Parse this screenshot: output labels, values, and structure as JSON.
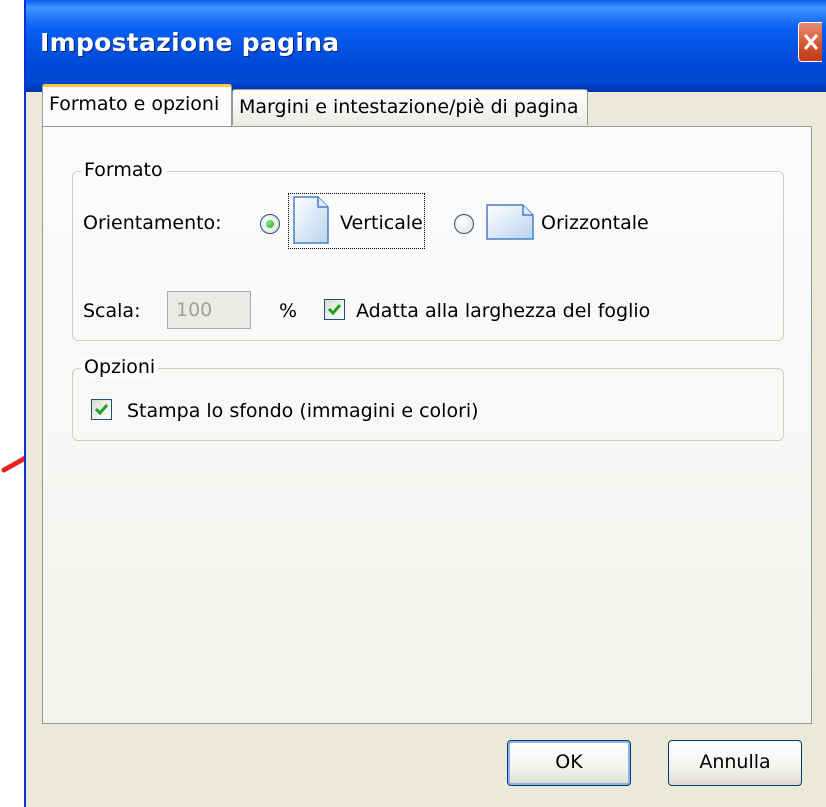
{
  "window": {
    "title": "Impostazione pagina",
    "close_icon": "close-icon"
  },
  "tabs": [
    {
      "label": "Formato e opzioni",
      "active": true
    },
    {
      "label": "Margini e intestazione/piè di pagina",
      "active": false
    }
  ],
  "formato": {
    "legend": "Formato",
    "orientation_label": "Orientamento:",
    "orientation_options": [
      {
        "label": "Verticale",
        "selected": true,
        "icon": "portrait-page-icon"
      },
      {
        "label": "Orizzontale",
        "selected": false,
        "icon": "landscape-page-icon"
      }
    ],
    "scale_label": "Scala:",
    "scale_value": "100",
    "percent": "%",
    "fit_width_label": "Adatta alla larghezza del foglio",
    "fit_width_checked": true
  },
  "opzioni": {
    "legend": "Opzioni",
    "print_background_label": "Stampa lo sfondo (immagini e colori)",
    "print_background_checked": true
  },
  "buttons": {
    "ok": "OK",
    "cancel": "Annulla"
  },
  "colors": {
    "titlebar": "#0054e3",
    "dialog_bg": "#ece9d8",
    "active_tab_accent": "#ffc83c",
    "annotation_arrow": "#e8231e"
  }
}
